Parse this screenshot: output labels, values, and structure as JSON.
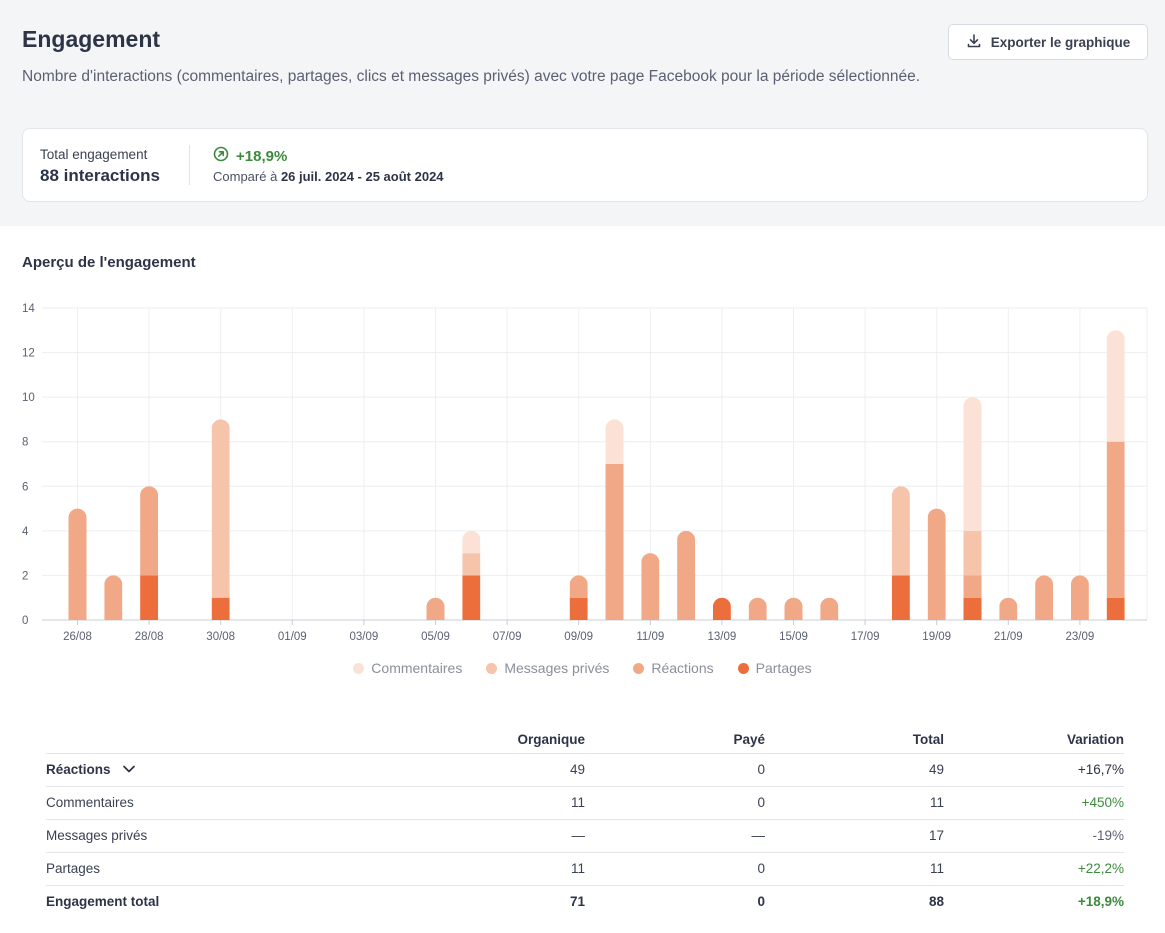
{
  "header": {
    "title": "Engagement",
    "description": "Nombre d'interactions (commentaires, partages, clics et messages privés) avec votre page Facebook pour la période sélectionnée.",
    "export_label": "Exporter le graphique"
  },
  "summary": {
    "label": "Total engagement",
    "value": "88 interactions",
    "change": "+18,9%",
    "compare_prefix": "Comparé à",
    "compare_range": "26 juil. 2024 - 25 août 2024"
  },
  "section_title": "Aperçu de l'engagement",
  "colors": {
    "commentaires": "#fbe1d6",
    "messages_prives": "#f6c4ab",
    "reactions": "#f1a887",
    "partages": "#ec6e3d",
    "positive": "#3c8a3c"
  },
  "chart_data": {
    "type": "bar",
    "stacked": true,
    "ylim": [
      0,
      14
    ],
    "yticks": [
      0,
      2,
      4,
      6,
      8,
      10,
      12,
      14
    ],
    "xticks": [
      "26/08",
      "28/08",
      "30/08",
      "01/09",
      "03/09",
      "05/09",
      "07/09",
      "09/09",
      "11/09",
      "13/09",
      "15/09",
      "17/09",
      "19/09",
      "21/09",
      "23/09"
    ],
    "categories": [
      "26/08",
      "27/08",
      "28/08",
      "29/08",
      "30/08",
      "31/08",
      "01/09",
      "02/09",
      "03/09",
      "04/09",
      "05/09",
      "06/09",
      "07/09",
      "08/09",
      "09/09",
      "10/09",
      "11/09",
      "12/09",
      "13/09",
      "14/09",
      "15/09",
      "16/09",
      "17/09",
      "18/09",
      "19/09",
      "20/09",
      "21/09",
      "22/09",
      "23/09",
      "24/09"
    ],
    "series": [
      {
        "name": "Partages",
        "color": "#ec6e3d",
        "values": [
          0,
          0,
          2,
          0,
          1,
          0,
          0,
          0,
          0,
          0,
          0,
          2,
          0,
          0,
          1,
          0,
          0,
          0,
          1,
          0,
          0,
          0,
          0,
          2,
          0,
          1,
          0,
          0,
          0,
          1
        ]
      },
      {
        "name": "Réactions",
        "color": "#f1a887",
        "values": [
          5,
          2,
          4,
          0,
          0,
          0,
          0,
          0,
          0,
          0,
          1,
          0,
          0,
          0,
          1,
          7,
          3,
          4,
          0,
          1,
          1,
          1,
          0,
          0,
          5,
          1,
          1,
          2,
          2,
          7
        ]
      },
      {
        "name": "Messages privés",
        "color": "#f6c4ab",
        "values": [
          0,
          0,
          0,
          0,
          8,
          0,
          0,
          0,
          0,
          0,
          0,
          1,
          0,
          0,
          0,
          0,
          0,
          0,
          0,
          0,
          0,
          0,
          0,
          4,
          0,
          2,
          0,
          0,
          0,
          0
        ]
      },
      {
        "name": "Commentaires",
        "color": "#fbe1d6",
        "values": [
          0,
          0,
          0,
          0,
          0,
          0,
          0,
          0,
          0,
          0,
          0,
          1,
          0,
          0,
          0,
          2,
          0,
          0,
          0,
          0,
          0,
          0,
          0,
          0,
          0,
          6,
          0,
          0,
          0,
          5
        ]
      }
    ],
    "legend": [
      "Commentaires",
      "Messages privés",
      "Réactions",
      "Partages"
    ],
    "legend_position": "bottom-center",
    "grid": true
  },
  "table": {
    "headers": [
      "",
      "Organique",
      "Payé",
      "Total",
      "Variation"
    ],
    "rows": [
      {
        "label": "Réactions",
        "organique": "49",
        "paye": "0",
        "total": "49",
        "variation": "+16,7%"
      },
      {
        "label": "Commentaires",
        "organique": "11",
        "paye": "0",
        "total": "11",
        "variation": "+450%"
      },
      {
        "label": "Messages privés",
        "organique": "—",
        "paye": "—",
        "total": "17",
        "variation": "-19%"
      },
      {
        "label": "Partages",
        "organique": "11",
        "paye": "0",
        "total": "11",
        "variation": "+22,2%"
      },
      {
        "label": "Engagement total",
        "organique": "71",
        "paye": "0",
        "total": "88",
        "variation": "+18,9%"
      }
    ]
  }
}
